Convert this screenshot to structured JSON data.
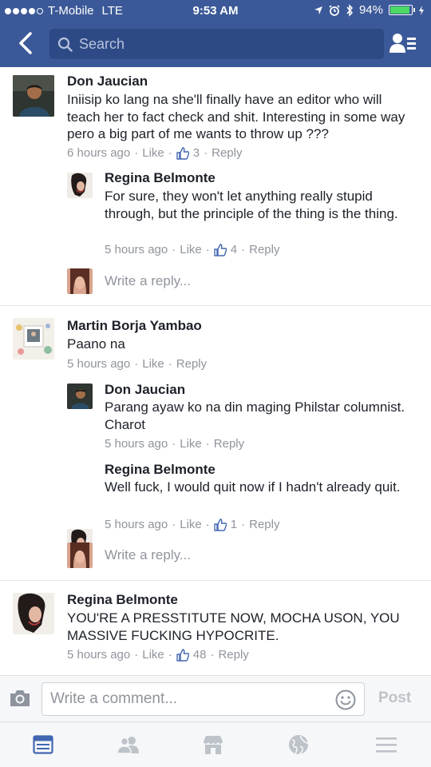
{
  "status_bar": {
    "carrier": "T-Mobile",
    "network": "LTE",
    "time": "9:53 AM",
    "battery": "94%",
    "battery_level": 0.94
  },
  "search": {
    "placeholder": "Search"
  },
  "threads": [
    {
      "name": "Don Jaucian",
      "text": "Iniisip ko lang na she'll finally have an editor who will teach her to fact check and shit. Interesting in some way pero a big part of me wants to throw up ???",
      "time": "6 hours ago",
      "like": "Like",
      "likes": "3",
      "reply": "Reply",
      "replies": [
        {
          "name": "Regina Belmonte",
          "text": "For sure, they won't let anything really stupid through, but the principle of the thing is the thing.",
          "time": "5 hours ago",
          "like": "Like",
          "likes": "4",
          "reply": "Reply"
        }
      ],
      "write_reply": "Write a reply..."
    },
    {
      "name": "Martin Borja Yambao",
      "text": "Paano na",
      "time": "5 hours ago",
      "like": "Like",
      "reply": "Reply",
      "replies": [
        {
          "name": "Don Jaucian",
          "text": "Parang ayaw ko na din maging Philstar columnist. Charot",
          "time": "5 hours ago",
          "like": "Like",
          "reply": "Reply"
        },
        {
          "name": "Regina Belmonte",
          "text": "Well fuck, I would quit now if I hadn't already quit.",
          "time": "5 hours ago",
          "like": "Like",
          "likes": "1",
          "reply": "Reply"
        }
      ],
      "write_reply": "Write a reply..."
    },
    {
      "name": "Regina Belmonte",
      "text": "YOU'RE A PRESSTITUTE NOW, MOCHA USON, YOU MASSIVE FUCKING HYPOCRITE.",
      "time": "5 hours ago",
      "like": "Like",
      "likes": "48",
      "reply": "Reply"
    }
  ],
  "composer": {
    "placeholder": "Write a comment...",
    "post_label": "Post"
  },
  "tabs": [
    {
      "icon": "news-feed-icon",
      "active": true
    },
    {
      "icon": "friends-icon"
    },
    {
      "icon": "marketplace-icon"
    },
    {
      "icon": "globe-icon"
    },
    {
      "icon": "menu-icon"
    }
  ],
  "colors": {
    "header": "#3b5998",
    "link_blue": "#4267b2",
    "meta_gray": "#90949c"
  }
}
